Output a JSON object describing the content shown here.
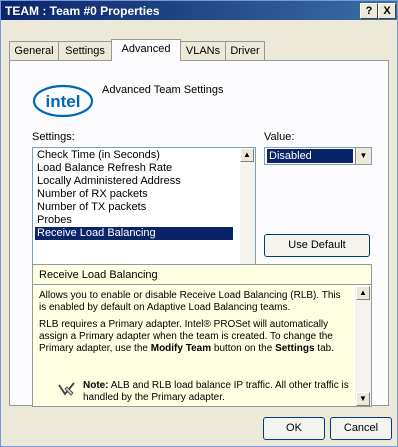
{
  "window": {
    "title": "TEAM : Team #0 Properties",
    "help_label": "?",
    "close_label": "X"
  },
  "tabs": [
    {
      "label": "General"
    },
    {
      "label": "Settings"
    },
    {
      "label": "Advanced"
    },
    {
      "label": "VLANs"
    },
    {
      "label": "Driver"
    }
  ],
  "logo": {
    "text": "intel"
  },
  "heading": "Advanced Team Settings",
  "settings": {
    "label": "Settings:",
    "items": [
      "Check Time (in Seconds)",
      "Load Balance Refresh Rate",
      "Locally Administered Address",
      "Number of RX packets",
      "Number of TX packets",
      "Probes",
      "Receive Load Balancing"
    ],
    "selected": "Receive Load Balancing"
  },
  "value": {
    "label": "Value:",
    "selected": "Disabled"
  },
  "use_default_label": "Use Default",
  "description": {
    "title": "Receive Load Balancing",
    "p1": "Allows you to enable or disable Receive Load Balancing (RLB). This is enabled by default on Adaptive Load Balancing teams.",
    "p2_a": "RLB requires a Primary adapter. Intel® PROSet will automatically assign a Primary adapter when the team is created. To change the Primary adapter, use the ",
    "p2_b": "Modify Team",
    "p2_c": " button on the ",
    "p2_d": "Settings",
    "p2_e": " tab.",
    "note_label": "Note:",
    "note_text": " ALB and RLB load balance IP traffic. All other traffic is handled by the Primary adapter."
  },
  "footer": {
    "ok_label": "OK",
    "cancel_label": "Cancel"
  },
  "colors": {
    "title_bar": "#0a246a",
    "selection": "#0a246a",
    "dialog_bg": "#ece9d8",
    "info_bg": "#ffffe1",
    "intel_blue": "#0068b5"
  }
}
